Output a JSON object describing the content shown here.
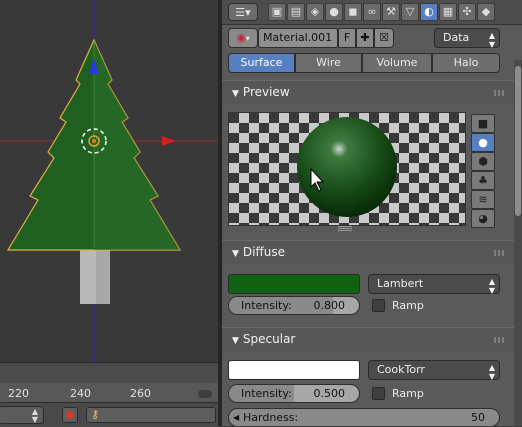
{
  "timeline": {
    "ticks": [
      "220",
      "240",
      "260"
    ]
  },
  "header": {
    "context_icons": [
      "render-icon",
      "render-layers-icon",
      "scene-icon",
      "world-icon",
      "object-icon",
      "constraints-icon",
      "modifier-icon",
      "data-icon",
      "material-icon",
      "texture-icon",
      "particles-icon",
      "physics-icon"
    ],
    "active_context": "material-icon"
  },
  "material": {
    "name": "Material.001",
    "fake_user": "F",
    "data_link": "Data"
  },
  "tabs": [
    "Surface",
    "Wire",
    "Volume",
    "Halo"
  ],
  "active_tab": "Surface",
  "preview": {
    "title": "Preview"
  },
  "diffuse": {
    "title": "Diffuse",
    "color": "#106110",
    "shader": "Lambert",
    "intensity_label": "Intensity:",
    "intensity_value": "0.800",
    "intensity_fraction": 0.8,
    "ramp_label": "Ramp"
  },
  "specular": {
    "title": "Specular",
    "color": "#ffffff",
    "shader": "CookTorr",
    "intensity_label": "Intensity:",
    "intensity_value": "0.500",
    "intensity_fraction": 0.5,
    "ramp_label": "Ramp",
    "hardness_label": "Hardness:",
    "hardness_value": "50"
  }
}
